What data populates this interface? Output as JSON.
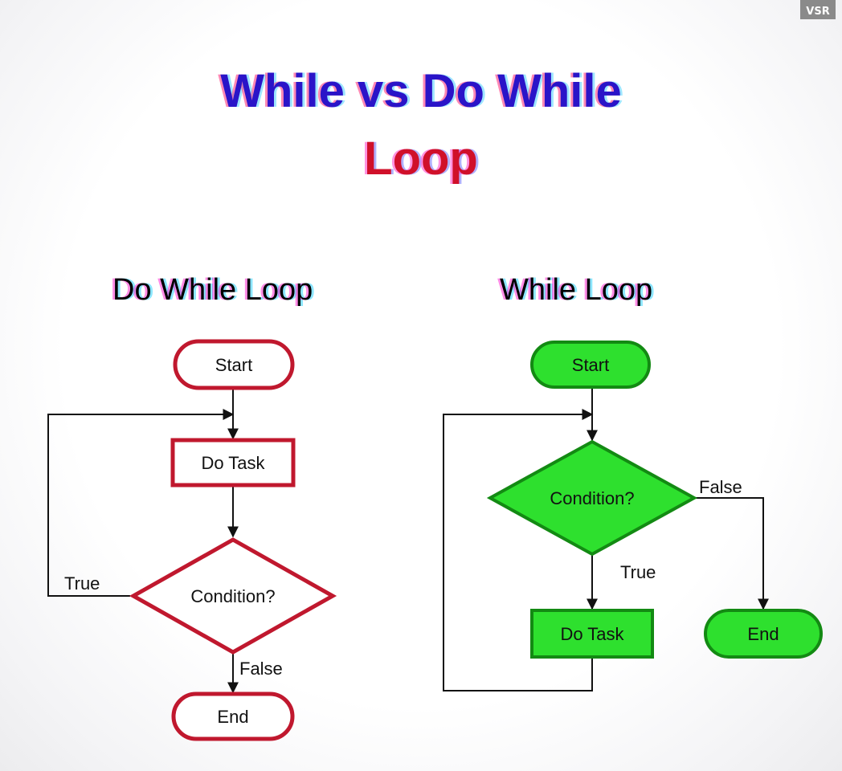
{
  "badge": "VSR",
  "title": {
    "line1": "While vs Do While",
    "line2": "Loop"
  },
  "colors": {
    "title_line1": "#2a14c8",
    "title_line2": "#d0102a",
    "do_while_border": "#c0182e",
    "do_while_fill": "#ffffff",
    "while_fill": "#2ee02e",
    "while_border": "#138a13",
    "line": "#111111"
  },
  "do_while": {
    "heading": "Do While Loop",
    "start": "Start",
    "task": "Do Task",
    "condition": "Condition?",
    "true_label": "True",
    "false_label": "False",
    "end": "End"
  },
  "while": {
    "heading": "While Loop",
    "start": "Start",
    "condition": "Condition?",
    "true_label": "True",
    "false_label": "False",
    "task": "Do Task",
    "end": "End"
  }
}
